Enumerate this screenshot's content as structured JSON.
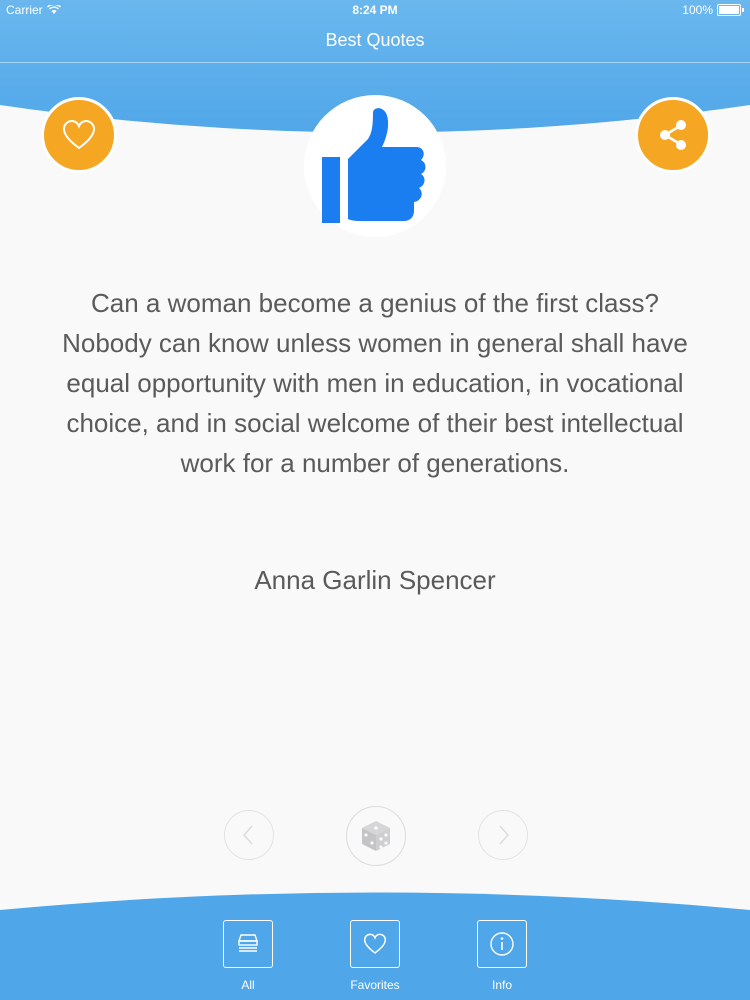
{
  "status_bar": {
    "carrier": "Carrier",
    "time": "8:24 PM",
    "battery": "100%"
  },
  "nav": {
    "title": "Best Quotes"
  },
  "actions": {
    "favorite_icon": "heart-icon",
    "share_icon": "share-icon",
    "hero_icon": "thumbs-up-icon"
  },
  "quote": {
    "text": "Can a woman become a genius of the first class? Nobody can know unless women in general shall have equal opportunity with men in education, in vocational choice, and in social welcome of their best intellectual work for a number of generations.",
    "author": "Anna Garlin Spencer"
  },
  "controls": {
    "prev_icon": "chevron-left-icon",
    "random_icon": "dice-icon",
    "next_icon": "chevron-right-icon"
  },
  "tabs": [
    {
      "label": "All",
      "icon": "inbox-stack-icon"
    },
    {
      "label": "Favorites",
      "icon": "heart-icon"
    },
    {
      "label": "Info",
      "icon": "info-icon"
    }
  ],
  "colors": {
    "header_blue": "#4fa6e8",
    "accent_orange": "#f5a623",
    "thumb_blue": "#1a7ef0"
  }
}
